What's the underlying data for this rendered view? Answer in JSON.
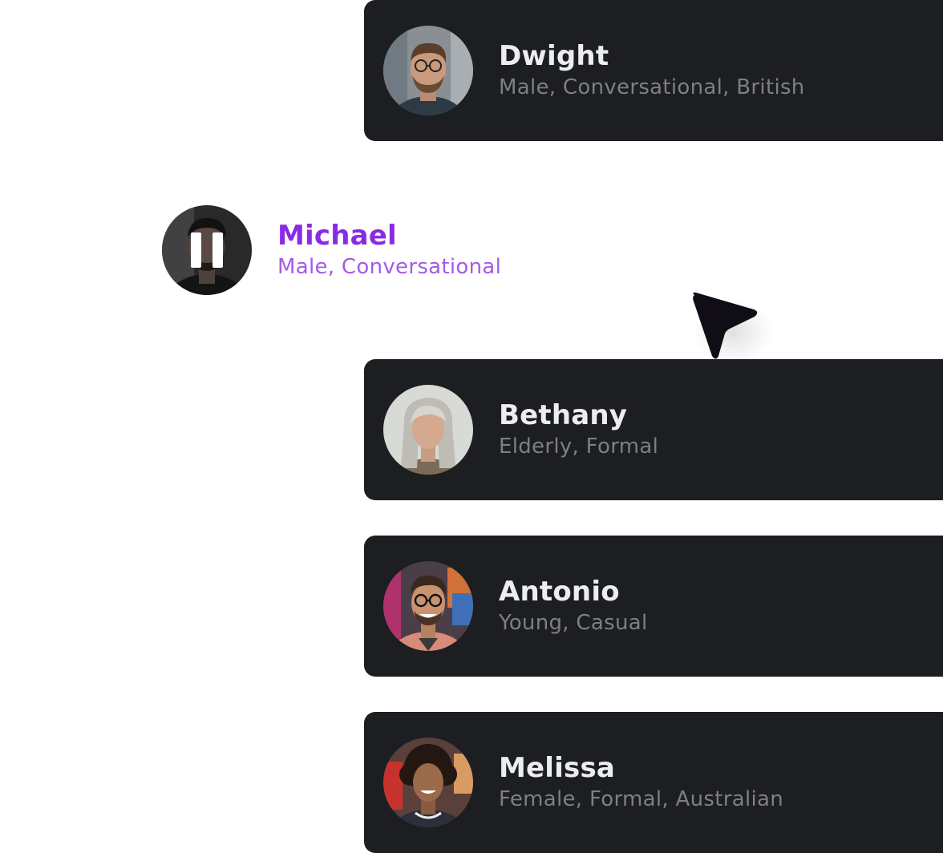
{
  "voices": [
    {
      "name": "Dwight",
      "description": "Male, Conversational, British",
      "avatar": "man-glasses-beard-avatar"
    },
    {
      "name": "Bethany",
      "description": "Elderly, Formal",
      "avatar": "older-woman-gray-hair-avatar"
    },
    {
      "name": "Antonio",
      "description": "Young, Casual",
      "avatar": "smiling-man-glasses-avatar"
    },
    {
      "name": "Melissa",
      "description": "Female, Formal, Australian",
      "avatar": "woman-curly-hair-avatar"
    }
  ],
  "active_voice": {
    "name": "Michael",
    "description": "Male, Conversational",
    "avatar": "man-dark-avatar",
    "state_icon": "pause-icon"
  },
  "cursor_icon": "pointer-cursor-icon",
  "colors": {
    "card_bg": "#1d1e21",
    "name_text": "#ecedef",
    "meta_text": "#7d7f85",
    "accent": "#8a2be2",
    "accent_light": "#a45ae6"
  }
}
